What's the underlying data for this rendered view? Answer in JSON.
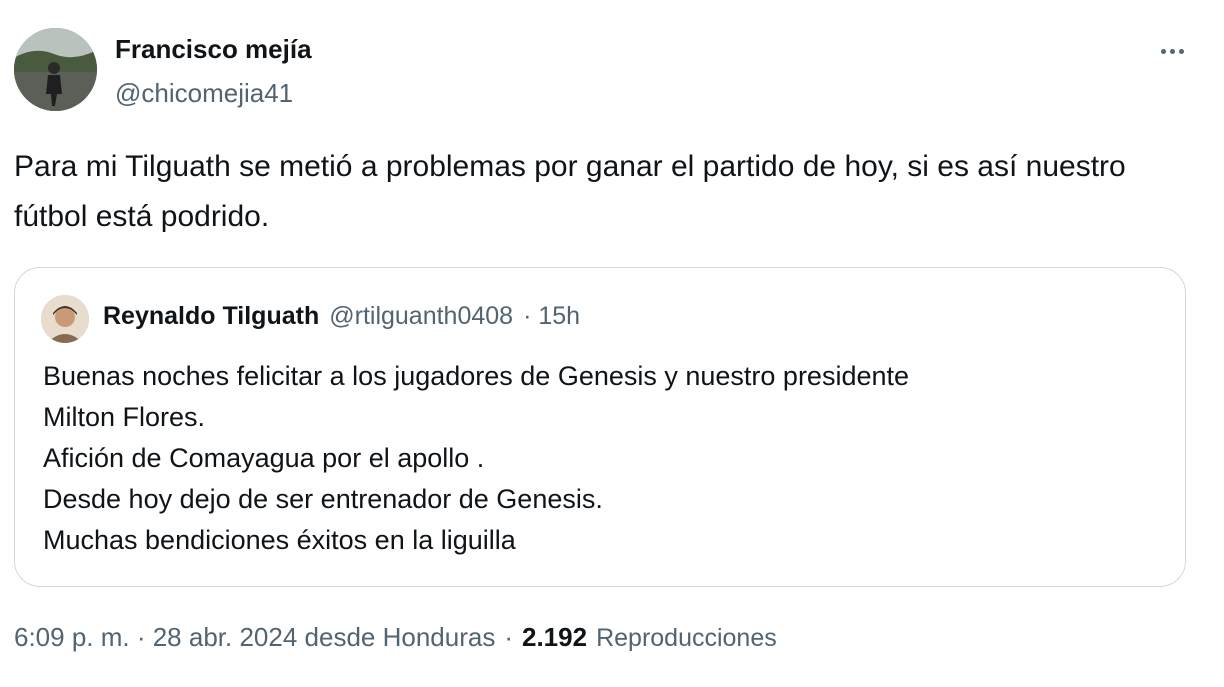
{
  "tweet": {
    "author": {
      "name": "Francisco mejía",
      "handle": "@chicomejia41"
    },
    "more_icon": "more-horizontal-icon",
    "text": "Para mi Tilguath se metió a problemas por ganar el partido de hoy, si es así nuestro fútbol está podrido.",
    "quote": {
      "author": {
        "name": "Reynaldo Tilguath",
        "handle": "@rtilguanth0408",
        "time": "· 15h"
      },
      "lines": [
        "Buenas noches felicitar a los jugadores de Genesis y nuestro presidente",
        "Milton Flores.",
        "Afición de Comayagua por el apollo .",
        "Desde hoy dejo de ser entrenador de Genesis.",
        "Muchas bendiciones éxitos en la liguilla"
      ]
    },
    "meta": {
      "time_location": "6:09 p. m. · 28 abr. 2024 desde Honduras",
      "separator": "·",
      "views_count": "2.192",
      "views_label": "Reproducciones"
    }
  },
  "colors": {
    "text_primary": "#0f1419",
    "text_secondary": "#536471",
    "border": "#cfd9de"
  }
}
